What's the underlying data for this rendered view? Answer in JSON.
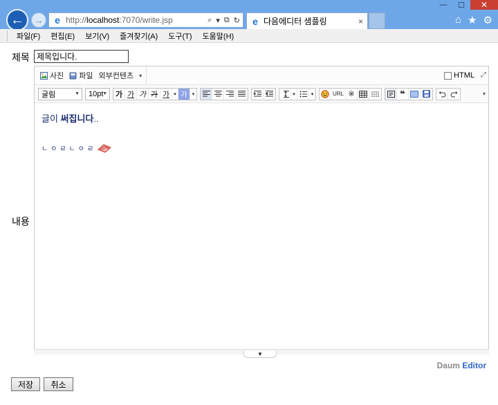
{
  "window": {
    "minimize": "—",
    "maximize": "☐",
    "close": "✕"
  },
  "browser": {
    "address_prefix": "http://",
    "address_host": "localhost",
    "address_rest": ":7070/write.jsp",
    "search_icon": "⌕",
    "dropdown_icon": "▾",
    "compat_icon": "⧉",
    "refresh_icon": "↻",
    "tab_title": "다음에디터 샘플링",
    "tab_close": "×",
    "home_icon": "⌂",
    "favorites_icon": "★",
    "tools_icon": "⚙"
  },
  "menu": {
    "items": [
      "파일(F)",
      "편집(E)",
      "보기(V)",
      "즐겨찾기(A)",
      "도구(T)",
      "도움말(H)"
    ]
  },
  "form": {
    "title_label": "제목",
    "title_value": "제목입니다.",
    "content_label": "내용",
    "save_button": "저장",
    "cancel_button": "취소"
  },
  "editor": {
    "toolbar1": {
      "photo": "사진",
      "file": "파일",
      "external": "외부컨텐츠",
      "html_toggle": "HTML"
    },
    "toolbar2": {
      "font_family": "굴림",
      "font_size": "10pt",
      "bold": "가",
      "underline": "가",
      "italic": "가",
      "strike": "가",
      "font_color": "가",
      "bg_color": "가",
      "url": "URL",
      "special_char": "※",
      "quote": "❝"
    },
    "body": {
      "text_before": "글이 ",
      "text_bold": "써집니다",
      "text_after": "..",
      "doodle": "ㄴㅇㄹㄴㅇㄹ"
    },
    "brand_prefix": "Daum",
    "brand_suffix": "Editor",
    "colors": {
      "accent_blue": "#2f66c6",
      "text_navy": "#1b2b6e",
      "chrome_blue": "#6ea7e8",
      "close_red": "#c94031"
    }
  }
}
